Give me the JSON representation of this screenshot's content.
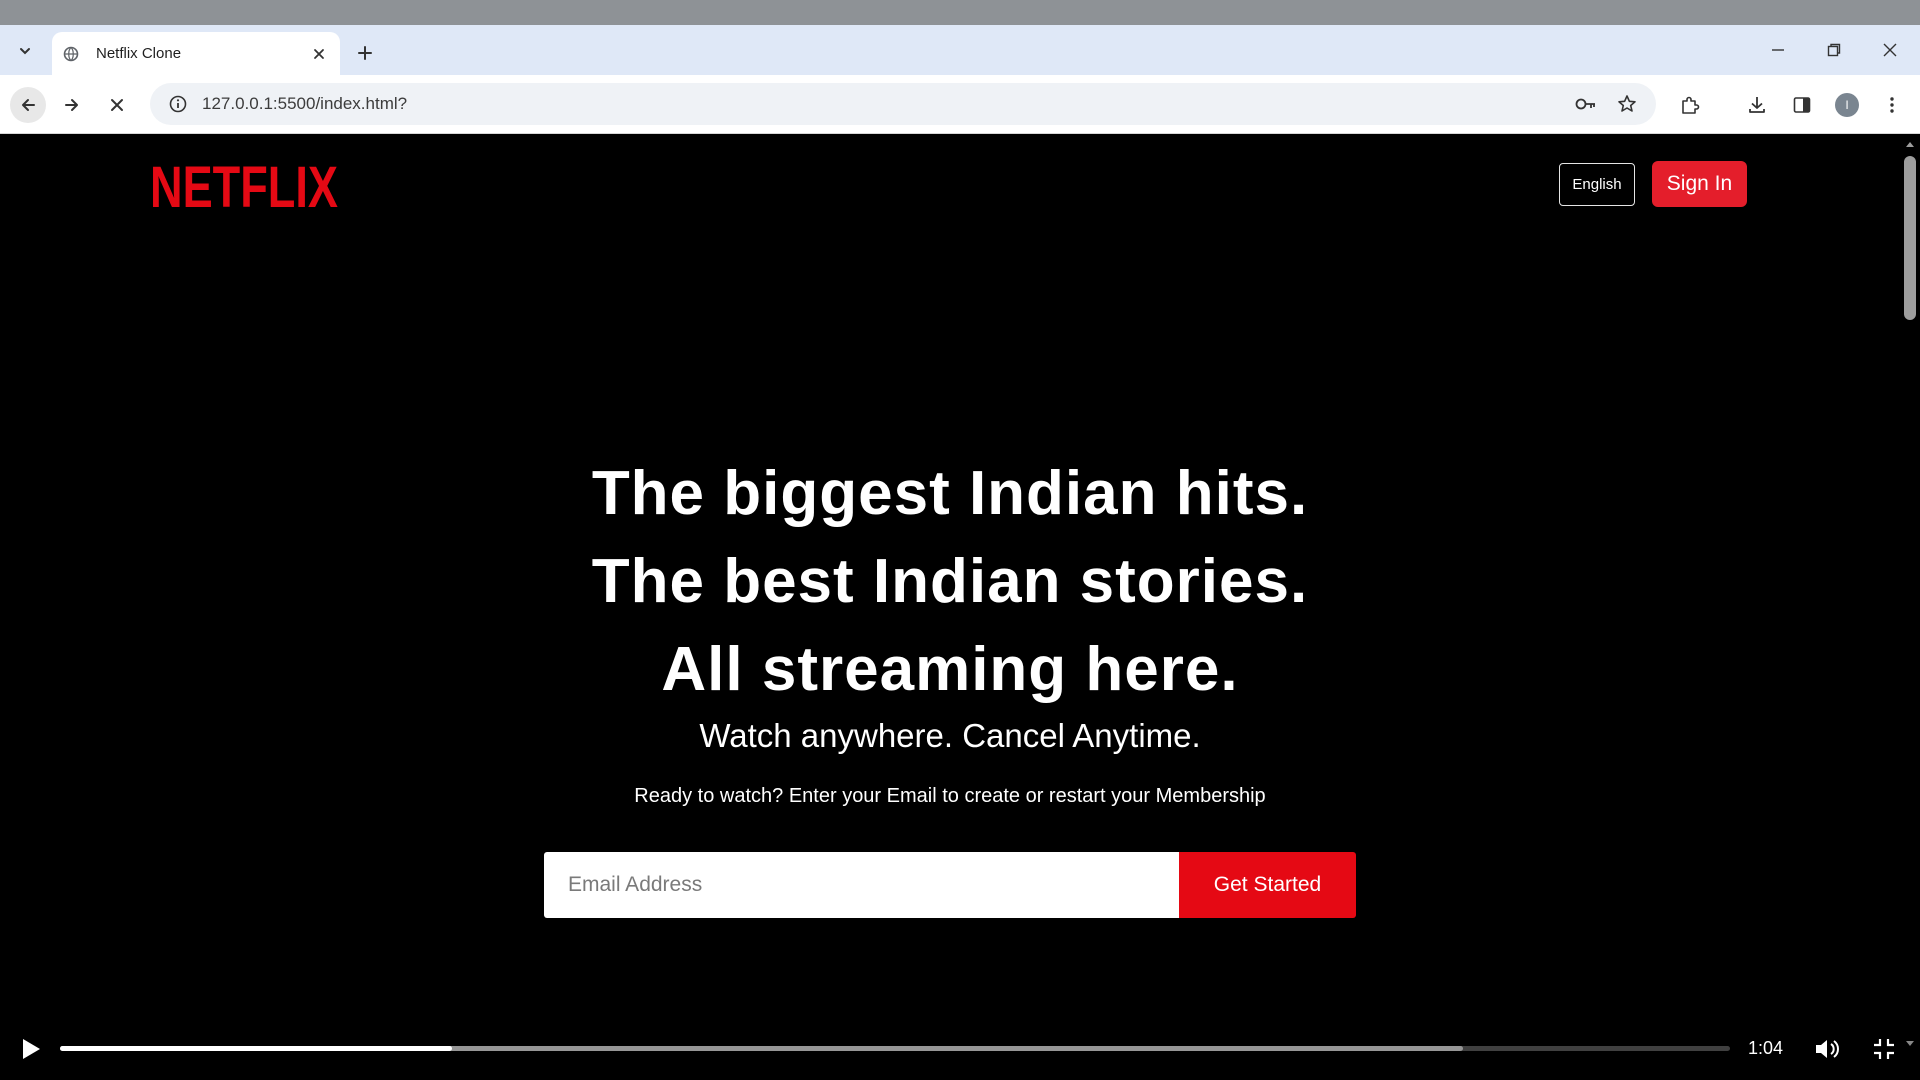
{
  "browser": {
    "tab_title": "Netflix Clone",
    "url": "127.0.0.1:5500/index.html?",
    "profile_initial": "I"
  },
  "page": {
    "logo_text": "NETFLIX",
    "language_button": "English",
    "signin_button": "Sign In",
    "headline": {
      "line1": "The biggest Indian hits.",
      "line2": "The best Indian stories.",
      "line3": "All streaming here."
    },
    "subheading": "Watch anywhere. Cancel Anytime.",
    "cta_text": "Ready to watch? Enter your Email to create or restart your Membership",
    "email_placeholder": "Email Address",
    "get_started_button": "Get Started"
  },
  "player": {
    "time": "1:04",
    "played_fraction": 0.235,
    "buffered_fraction": 0.84
  },
  "colors": {
    "brand_red": "#e50914",
    "signin_red": "#e41e2b",
    "tabbar_bg": "#dfe8f7"
  },
  "icons": {
    "tab_search": "chevron-down-icon",
    "favicon": "globe-icon",
    "tab_close": "close-icon",
    "new_tab": "plus-icon",
    "back": "back-arrow-icon",
    "forward": "forward-arrow-icon",
    "stop": "stop-icon",
    "site_info": "info-icon",
    "password": "key-icon",
    "bookmark": "star-icon",
    "extensions": "puzzle-icon",
    "downloads": "download-icon",
    "side_panel": "side-panel-icon",
    "menu": "kebab-menu-icon",
    "play": "play-icon",
    "volume": "volume-icon",
    "fullscreen": "fullscreen-icon"
  }
}
